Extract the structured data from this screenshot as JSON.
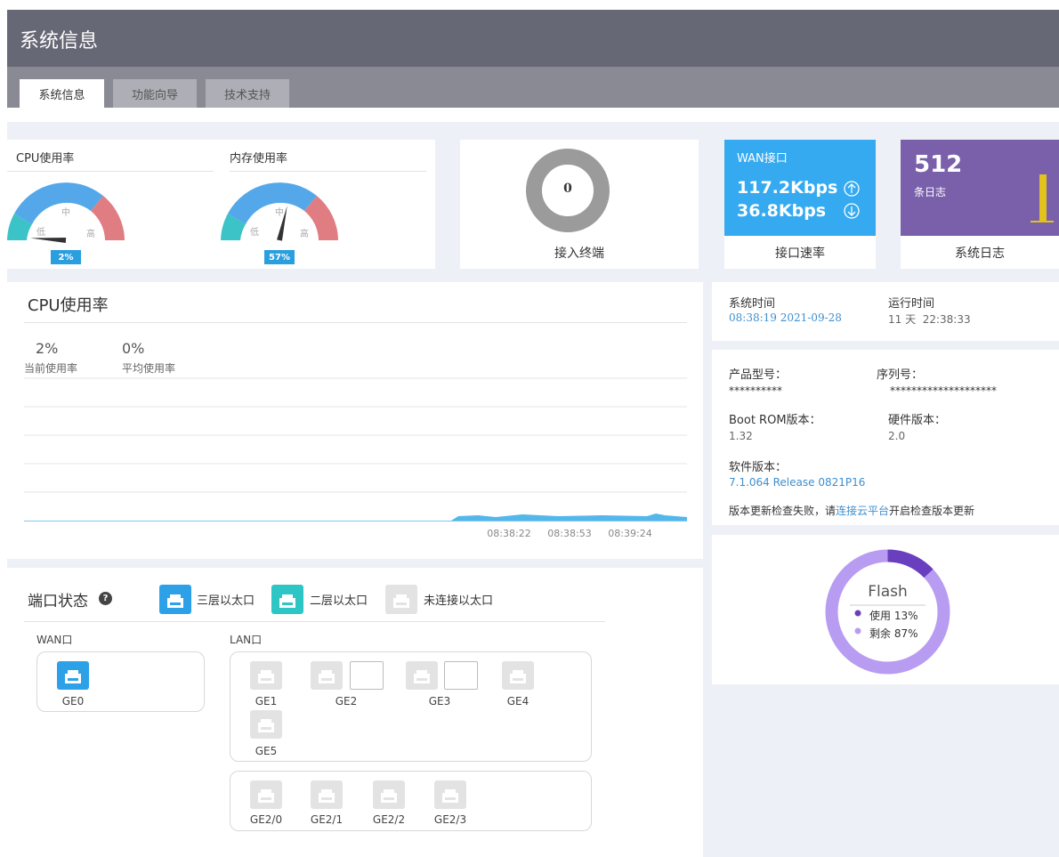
{
  "header": {
    "title": "系统信息"
  },
  "tabs": [
    {
      "label": "系统信息",
      "active": true
    },
    {
      "label": "功能向导",
      "active": false
    },
    {
      "label": "技术支持",
      "active": false
    }
  ],
  "cpu_gauge": {
    "title": "CPU使用率",
    "low": "低",
    "mid": "中",
    "high": "高",
    "value": "2%",
    "level": 0.02
  },
  "mem_gauge": {
    "title": "内存使用率",
    "low": "低",
    "mid": "中",
    "high": "高",
    "value": "57%",
    "level": 0.57
  },
  "terminals": {
    "count": "0",
    "label": "接入终端"
  },
  "wan": {
    "title": "WAN接口",
    "up": "117.2Kbps",
    "down": "36.8Kbps",
    "caption": "接口速率",
    "up_icon": "arrow-up-circle-icon",
    "down_icon": "arrow-down-circle-icon"
  },
  "logs": {
    "count": "512",
    "unit": "条日志",
    "caption": "系统日志"
  },
  "cpu_chart": {
    "title": "CPU使用率",
    "current_value": "2%",
    "current_label": "当前使用率",
    "avg_value": "0%",
    "avg_label": "平均使用率",
    "xticks": [
      "08:38:22",
      "08:38:53",
      "08:39:24"
    ]
  },
  "chart_data": {
    "type": "area",
    "title": "CPU使用率",
    "x": [
      "08:38:22",
      "08:38:53",
      "08:39:24"
    ],
    "series": [
      {
        "values": [
          2,
          2,
          2
        ]
      }
    ],
    "grid": true
  },
  "sysinfo": {
    "time_label": "系统时间",
    "time_value": "08:38:19 2021-09-28",
    "uptime_label": "运行时间",
    "uptime_value": "11 天  22:38:33",
    "model_label": "产品型号：",
    "model_value": "**********",
    "serial_label": "序列号：",
    "serial_value": "********************",
    "bootrom_label": "Boot ROM版本：",
    "bootrom_value": "1.32",
    "hw_label": "硬件版本：",
    "hw_value": "2.0",
    "sw_label": "软件版本：",
    "sw_value": "7.1.064 Release 0821P16",
    "update_msg_pre": "版本更新检查失败，请",
    "update_link": "连接云平台",
    "update_msg_post": "开启检查版本更新"
  },
  "flash": {
    "title": "Flash",
    "used_label": "使用",
    "used_value": "13%",
    "free_label": "剩余",
    "free_value": "87%",
    "used_fraction": 0.13,
    "colors": {
      "used": "#6a3fbf",
      "free": "#b89cf2"
    }
  },
  "ports": {
    "title": "端口状态",
    "legend": [
      {
        "label": "三层以太口"
      },
      {
        "label": "二层以太口"
      },
      {
        "label": "未连接以太口"
      }
    ],
    "wan_label": "WAN口",
    "lan_label": "LAN口",
    "wan_ports": [
      "GE0"
    ],
    "lan_ports": [
      "GE1",
      "GE2",
      "GE3",
      "GE4",
      "GE5"
    ],
    "sub_ports": [
      "GE2/0",
      "GE2/1",
      "GE2/2",
      "GE2/3"
    ]
  }
}
